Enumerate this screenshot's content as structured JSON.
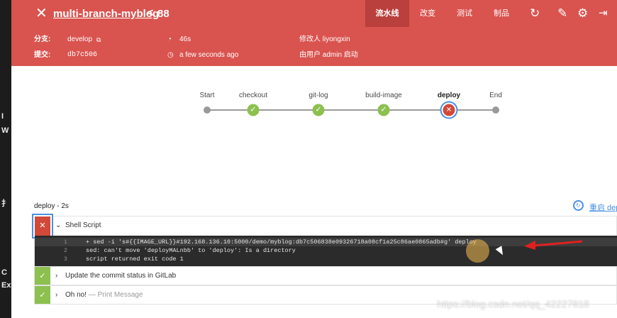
{
  "header": {
    "close_icon": "close-icon",
    "project_name": "multi-branch-myblog",
    "separator": "<",
    "run_number": "88",
    "tabs": [
      {
        "label": "流水线",
        "active": true
      },
      {
        "label": "改变",
        "active": false
      },
      {
        "label": "测试",
        "active": false
      },
      {
        "label": "制品",
        "active": false
      }
    ],
    "icons": [
      "replay-icon",
      "edit-icon",
      "settings-icon",
      "exit-icon"
    ],
    "color": "#d9534f"
  },
  "info": {
    "branch_label": "分支:",
    "branch_value": "develop",
    "commit_label": "提交:",
    "commit_value": "db7c506",
    "duration": "46s",
    "time_ago": "a few seconds ago",
    "author": "修改人 liyongxin",
    "started_by": "由用户 admin 启动"
  },
  "pipeline": {
    "stages": [
      {
        "label": "Start",
        "status": "start"
      },
      {
        "label": "checkout",
        "status": "success"
      },
      {
        "label": "git-log",
        "status": "success"
      },
      {
        "label": "build-image",
        "status": "success"
      },
      {
        "label": "deploy",
        "status": "failed"
      },
      {
        "label": "End",
        "status": "end"
      }
    ]
  },
  "detail": {
    "title": "deploy - 2s",
    "restart_label": "重启 dep",
    "steps": [
      {
        "title": "Shell Script",
        "sub": "",
        "status": "failed",
        "log": [
          {
            "num": "1",
            "text": "+ sed -i 's#{{IMAGE_URL}}#192.168.136.10:5000/demo/myblog:db7c506838e09326718a08cf1a25c86ae0865adb#g' deploy"
          },
          {
            "num": "2",
            "text": "sed: can't move 'deployMALnbb' to 'deploy': Is a directory"
          },
          {
            "num": "3",
            "text": "script returned exit code 1"
          }
        ]
      },
      {
        "title": "Update the commit status in GitLab",
        "sub": "",
        "status": "success"
      },
      {
        "title": "Oh no!",
        "sub": "— Print Message",
        "status": "success"
      }
    ]
  },
  "left_edge": [
    "W",
    "I",
    "扌",
    "C",
    "Ex"
  ],
  "watermark": "https://blog.csdn.net/qq_42227818",
  "colors": {
    "success": "#8cc04f",
    "failed": "#d24939",
    "link": "#4a90e2"
  }
}
